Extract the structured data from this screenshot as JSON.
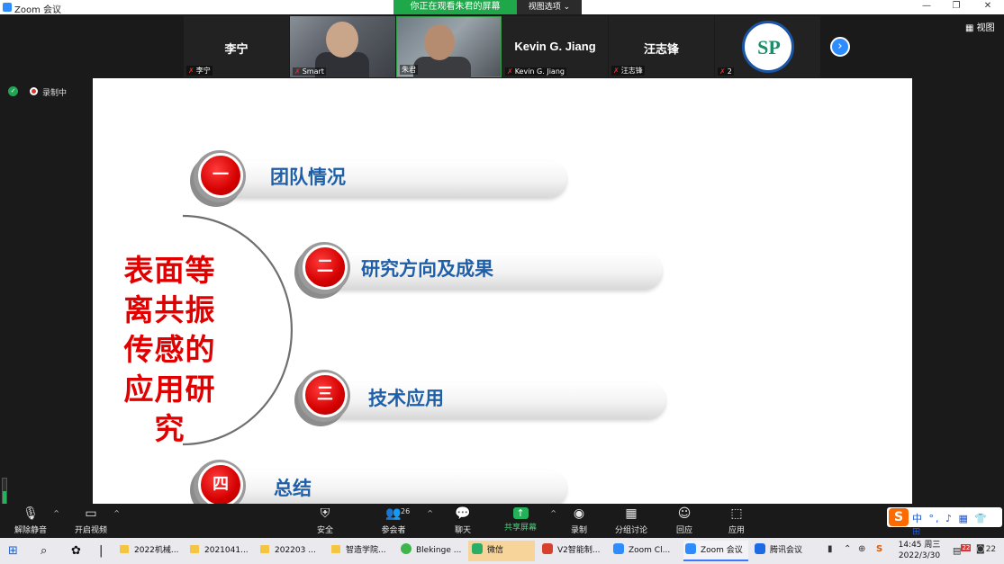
{
  "window": {
    "title": "Zoom 会议",
    "share_banner": "你正在观看朱君的屏幕",
    "view_options": "视图选项",
    "minimize": "—",
    "restore": "❐",
    "close": "✕"
  },
  "participants": [
    {
      "display_name": "李宁",
      "caption": "李宁"
    },
    {
      "display_name": "",
      "caption": "Smart"
    },
    {
      "display_name": "",
      "caption": "朱君"
    },
    {
      "display_name": "Kevin G. Jiang",
      "caption": "Kevin G. Jiang"
    },
    {
      "display_name": "汪志锋",
      "caption": "汪志锋"
    },
    {
      "display_name": "",
      "caption": "2"
    }
  ],
  "gallery_view_label": "视图",
  "recording_label": "录制中",
  "slide": {
    "title": "表面等离共振传感的应用研究",
    "title_lines": [
      "表面等",
      "离共振",
      "传感的",
      "应用研",
      "究"
    ],
    "items": [
      {
        "number": "一",
        "text": "团队情况"
      },
      {
        "number": "二",
        "text": "研究方向及成果"
      },
      {
        "number": "三",
        "text": "技术应用"
      },
      {
        "number": "四",
        "text": "总结"
      }
    ],
    "colors": {
      "title": "#e00000",
      "item_text": "#1f5fa8",
      "bullet": "#d40000"
    }
  },
  "toolbar": {
    "unmute": "解除静音",
    "start_video": "开启视频",
    "security": "安全",
    "participants": "参会者",
    "participants_count": "26",
    "chat": "聊天",
    "share_screen": "共享屏幕",
    "record": "录制",
    "breakout": "分组讨论",
    "reactions": "回应",
    "apps": "应用"
  },
  "ime": {
    "logo": "S",
    "text": "中 °, ♪ ▦ 👕 ⊞"
  },
  "taskbar": {
    "items": [
      {
        "label": "2022机械..."
      },
      {
        "label": "2021041..."
      },
      {
        "label": "202203 ..."
      },
      {
        "label": "智造学院..."
      },
      {
        "label": "Blekinge ..."
      },
      {
        "label": "微信"
      },
      {
        "label": "V2智能制..."
      },
      {
        "label": "Zoom Cl..."
      },
      {
        "label": "Zoom 会议"
      },
      {
        "label": "腾讯会议"
      }
    ],
    "clock_time": "14:45 周三",
    "clock_date": "2022/3/30",
    "notifications": "22",
    "chat_badge": "22"
  }
}
